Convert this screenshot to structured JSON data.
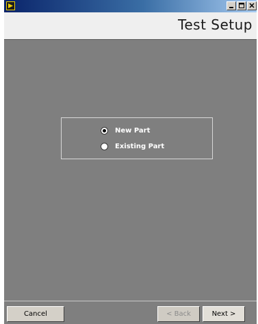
{
  "window": {
    "title": "Test Setup",
    "controls": {
      "minimize_icon": "minimize-icon",
      "maximize_icon": "maximize-icon",
      "close_icon": "close-icon"
    }
  },
  "options": [
    {
      "label": "New Part",
      "selected": true
    },
    {
      "label": "Existing Part",
      "selected": false
    }
  ],
  "buttons": {
    "cancel": "Cancel",
    "back": "< Back",
    "next": "Next >"
  },
  "colors": {
    "background": "#7f7f7f",
    "header": "#efefef",
    "titlebar_start": "#0a246a",
    "titlebar_end": "#a6caf0"
  }
}
